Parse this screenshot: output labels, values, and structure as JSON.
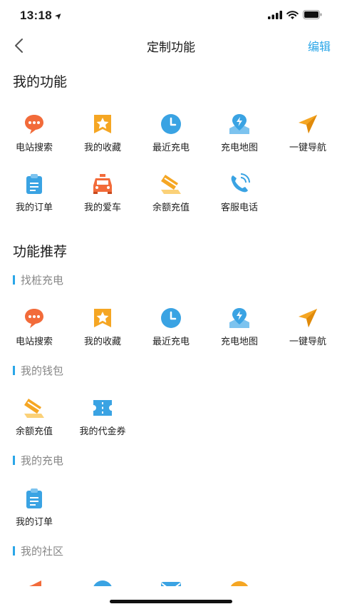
{
  "status_bar": {
    "time": "13:18"
  },
  "nav": {
    "title": "定制功能",
    "edit_label": "编辑"
  },
  "my_functions": {
    "title": "我的功能",
    "items": [
      {
        "label": "电站搜索",
        "icon": "chat-bubble-icon"
      },
      {
        "label": "我的收藏",
        "icon": "star-bookmark-icon"
      },
      {
        "label": "最近充电",
        "icon": "clock-icon"
      },
      {
        "label": "充电地图",
        "icon": "map-pin-icon"
      },
      {
        "label": "一键导航",
        "icon": "navigation-arrow-icon"
      },
      {
        "label": "我的订单",
        "icon": "clipboard-icon"
      },
      {
        "label": "我的爱车",
        "icon": "car-icon"
      },
      {
        "label": "余额充值",
        "icon": "card-icon"
      },
      {
        "label": "客服电话",
        "icon": "phone-icon"
      }
    ]
  },
  "recommend": {
    "title": "功能推荐",
    "groups": [
      {
        "title": "找桩充电",
        "items": [
          {
            "label": "电站搜索",
            "icon": "chat-bubble-icon"
          },
          {
            "label": "我的收藏",
            "icon": "star-bookmark-icon"
          },
          {
            "label": "最近充电",
            "icon": "clock-icon"
          },
          {
            "label": "充电地图",
            "icon": "map-pin-icon"
          },
          {
            "label": "一键导航",
            "icon": "navigation-arrow-icon"
          }
        ]
      },
      {
        "title": "我的钱包",
        "items": [
          {
            "label": "余额充值",
            "icon": "card-icon"
          },
          {
            "label": "我的代金券",
            "icon": "voucher-icon"
          }
        ]
      },
      {
        "title": "我的充电",
        "items": [
          {
            "label": "我的订单",
            "icon": "clipboard-icon"
          }
        ]
      },
      {
        "title": "我的社区",
        "items": []
      }
    ]
  },
  "colors": {
    "accent": "#2aa6e8",
    "orange": "#f5a623",
    "red_orange": "#f26b3a",
    "blue": "#3aa3e3"
  }
}
